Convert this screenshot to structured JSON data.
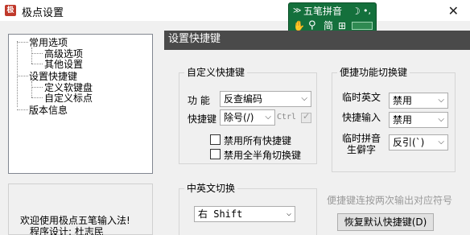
{
  "window": {
    "title": "极点设置",
    "close": "✕"
  },
  "ime": {
    "mode": "五笔拼音",
    "row1_left": "⨯",
    "row1_moon": "☽",
    "row1_punct": "•,",
    "simplified": "简",
    "grid": "⊞",
    "hand": "☚",
    "search": "🔍"
  },
  "tree": {
    "items": [
      {
        "label": "常用选项",
        "level": 0
      },
      {
        "label": "高级选项",
        "level": 1
      },
      {
        "label": "其他设置",
        "level": 1
      },
      {
        "label": "设置快捷键",
        "level": 0
      },
      {
        "label": "定义软键盘",
        "level": 1
      },
      {
        "label": "自定义标点",
        "level": 1
      },
      {
        "label": "版本信息",
        "level": 0
      }
    ]
  },
  "info": {
    "line1": "欢迎使用极点五笔输入法!",
    "line2": "程序设计: 杜志民"
  },
  "panel": {
    "header": "设置快捷键"
  },
  "custom_shortcut": {
    "title": "自定义快捷键",
    "function_label": "功  能",
    "function_value": "反查编码",
    "shortcut_label": "快捷键",
    "shortcut_value": "除号(/)",
    "ctrl_label": "Ctrl",
    "disable_all": "禁用所有快捷键",
    "disable_fullwidth": "禁用全半角切换键"
  },
  "quick_switch": {
    "title": "便捷功能切换键",
    "temp_english_label": "临时英文",
    "temp_english_value": "禁用",
    "quick_input_label": "快捷输入",
    "quick_input_value": "禁用",
    "temp_pinyin_label1": "临时拼音",
    "temp_pinyin_label2": "生僻字",
    "temp_pinyin_value": "反引(`)"
  },
  "cn_en_switch": {
    "title": "中英文切换",
    "value": "右 Shift"
  },
  "hint": "便捷键连按两次输出对应符号",
  "restore_button": "恢复默认快捷键(D)"
}
